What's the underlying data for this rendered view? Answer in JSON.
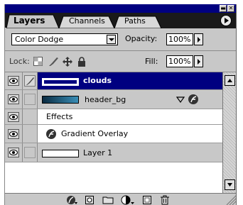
{
  "window": {
    "minimize_glyph": "▬",
    "close_glyph": "✕"
  },
  "tabs": [
    {
      "label": "Layers",
      "active": true
    },
    {
      "label": "Channels",
      "active": false
    },
    {
      "label": "Paths",
      "active": false
    }
  ],
  "blend": {
    "mode": "Color Dodge",
    "opacity_label": "Opacity:",
    "opacity_value": "100%"
  },
  "lock": {
    "label": "Lock:",
    "fill_label": "Fill:",
    "fill_value": "100%"
  },
  "layers": [
    {
      "name": "clouds",
      "selected": true
    },
    {
      "name": "header_bg",
      "selected": false
    },
    {
      "name": "Effects",
      "type": "effects-header"
    },
    {
      "name": "Gradient Overlay",
      "type": "effect"
    },
    {
      "name": "Layer 1",
      "selected": false
    }
  ],
  "colors": {
    "selection": "#000080",
    "panel": "#c8c8c8",
    "tab_bar": "#1a1a1a"
  },
  "icons": {
    "bottom": [
      "layer-style-icon",
      "add-mask-icon",
      "new-set-icon",
      "adjustment-layer-icon",
      "new-layer-icon",
      "trash-icon"
    ]
  }
}
